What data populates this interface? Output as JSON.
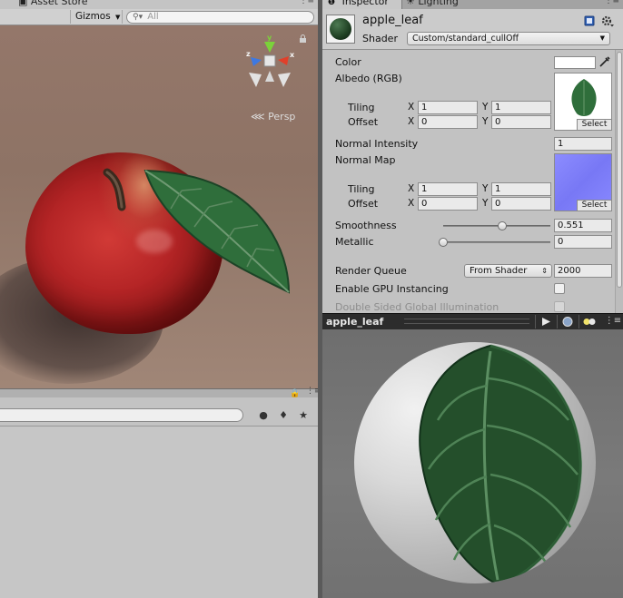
{
  "scene": {
    "tab_label": "Asset Store",
    "gizmos_label": "Gizmos",
    "search_placeholder": "All",
    "persp_label": "Persp",
    "gizmo_axes": {
      "y": "y",
      "x": "x",
      "z": "z"
    }
  },
  "inspector": {
    "tabs": [
      {
        "label": "Inspector",
        "active": true
      },
      {
        "label": "Lighting",
        "active": false
      }
    ],
    "material_name": "apple_leaf",
    "shader_label": "Shader",
    "shader_value": "Custom/standard_cullOff",
    "color_label": "Color",
    "color_value": "#ffffff",
    "albedo_label": "Albedo (RGB)",
    "tiling_label": "Tiling",
    "offset_label": "Offset",
    "x_label": "X",
    "y_label": "Y",
    "albedo_tiling": {
      "x": "1",
      "y": "1"
    },
    "albedo_offset": {
      "x": "0",
      "y": "0"
    },
    "select_label": "Select",
    "normal_intensity_label": "Normal Intensity",
    "normal_intensity_value": "1",
    "normal_map_label": "Normal Map",
    "normal_tiling": {
      "x": "1",
      "y": "1"
    },
    "normal_offset": {
      "x": "0",
      "y": "0"
    },
    "smoothness_label": "Smoothness",
    "smoothness_value": "0.551",
    "metallic_label": "Metallic",
    "metallic_value": "0",
    "render_queue_label": "Render Queue",
    "render_queue_mode": "From Shader",
    "render_queue_value": "2000",
    "gpu_instancing_label": "Enable GPU Instancing",
    "gpu_instancing_checked": false,
    "double_sided_gi_label": "Double Sided Global Illumination",
    "double_sided_gi_checked": false
  },
  "preview": {
    "title": "apple_leaf"
  },
  "colors": {
    "apple_red": "#b52526",
    "leaf_green": "#2f6e3b",
    "normal_map_blue": "#7f7fff",
    "scene_background": "#94776a",
    "panel_grey": "#c2c2c2"
  }
}
